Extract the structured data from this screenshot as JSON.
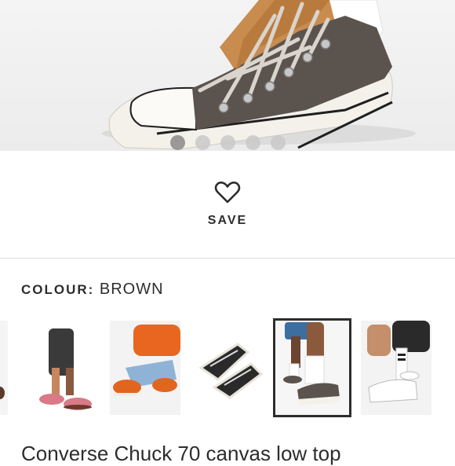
{
  "gallery": {
    "dots": [
      {
        "active": true
      },
      {
        "active": false
      },
      {
        "active": false
      },
      {
        "active": false
      },
      {
        "active": false
      }
    ],
    "shoe_colors": {
      "upper": "#5b534d",
      "lining": "#c98c4f",
      "sole": "#f3f1ea",
      "stripe": "#1f1f1f",
      "laces": "#d9d4cc"
    }
  },
  "save": {
    "label": "SAVE",
    "icon": "heart-outline-icon"
  },
  "colour": {
    "label": "COLOUR:",
    "value": "BROWN"
  },
  "colour_options": [
    {
      "name": "partial-swatch"
    },
    {
      "name": "pink-sole-swatch"
    },
    {
      "name": "orange-swatch"
    },
    {
      "name": "black-swatch"
    },
    {
      "name": "brown-swatch",
      "selected": true
    },
    {
      "name": "white-swatch"
    }
  ],
  "product": {
    "title_partial": "Converse Chuck 70 canvas low top"
  }
}
